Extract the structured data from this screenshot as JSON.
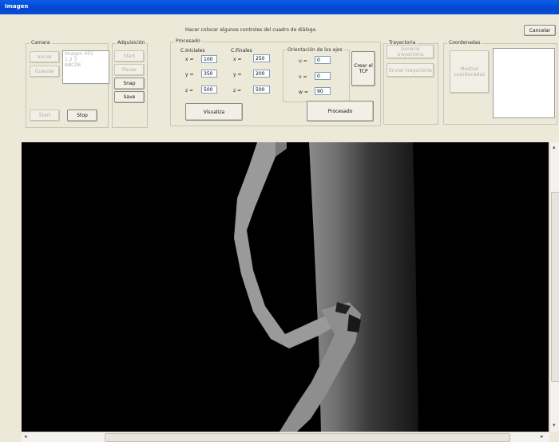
{
  "window": {
    "title": "Imagen"
  },
  "hint": "Hacer colocar algunos controles del cuadro de diálogo.",
  "cancel_label": "Cancelar",
  "camera": {
    "label": "Camara",
    "buttons": [
      "Iniciar",
      "Guardar",
      "Start",
      "Stop"
    ],
    "list": [
      "Imagen 001",
      "1 2 3",
      "ABCDE"
    ]
  },
  "adquisicion": {
    "label": "Adquisición",
    "buttons": [
      "Start",
      "Pause",
      "Snap",
      "Save"
    ]
  },
  "procesado": {
    "label": "Procesado",
    "c_iniciales_label": "C.Iniciales",
    "c_finales_label": "C.Finales",
    "axis_x": "x =",
    "axis_y": "y =",
    "axis_z": "z =",
    "c_iniciales": {
      "x": "100",
      "y": "350",
      "z": "500"
    },
    "c_finales": {
      "x": "250",
      "y": "200",
      "z": "500"
    },
    "orientacion_label": "Orientación de los ejes",
    "orient_labels": [
      "u =",
      "v =",
      "w ="
    ],
    "orient_values": [
      "0",
      "0",
      "90"
    ],
    "tcp_button": "Crear el TCP",
    "visualiza_button": "Visualiza",
    "procesado_button": "Procesado"
  },
  "trayectoria": {
    "label": "Trayectoria",
    "buttons": [
      "Generar trayectoria",
      "Enviar trayectoria"
    ]
  },
  "coordenadas": {
    "label": "Coordenadas",
    "button": "Mostrar coordenadas"
  },
  "colors": {
    "titlebar": "#0246cf",
    "dialog_bg": "#ece9d8",
    "image_bg": "#000000"
  }
}
